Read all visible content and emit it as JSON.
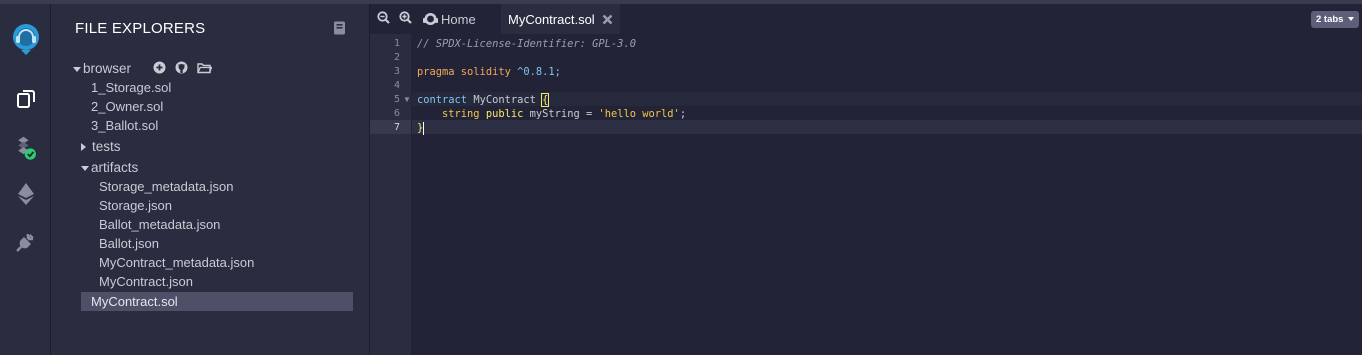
{
  "explorer": {
    "title": "FILE EXPLORERS",
    "workspace": "browser",
    "files": [
      "1_Storage.sol",
      "2_Owner.sol",
      "3_Ballot.sol"
    ],
    "folders": {
      "tests": "tests",
      "artifacts": "artifacts"
    },
    "artifact_files": [
      "Storage_metadata.json",
      "Storage.json",
      "Ballot_metadata.json",
      "Ballot.json",
      "MyContract_metadata.json",
      "MyContract.json"
    ],
    "selected_file": "MyContract.sol"
  },
  "tabs": {
    "home": "Home",
    "active": "MyContract.sol",
    "count_badge": "2 tabs"
  },
  "editor": {
    "line_numbers": [
      "1",
      "2",
      "3",
      "4",
      "5",
      "6",
      "7"
    ],
    "line1": "// SPDX-License-Identifier: GPL-3.0",
    "line3_kw": "pragma solidity",
    "line3_ver": "^0.8.1;",
    "line5_kw": "contract",
    "line5_name": "MyContract",
    "line5_brace": "{",
    "line6_type": "string",
    "line6_vis": "public",
    "line6_rest": "myString =",
    "line6_str": "'hello world'",
    "line6_end": ";",
    "line7": "}"
  },
  "colors": {
    "background": "#222336",
    "panel": "#2a2c3f",
    "selection": "#4e5068",
    "accent_blue": "#2b9bd8",
    "success_green": "#2ecc71"
  }
}
